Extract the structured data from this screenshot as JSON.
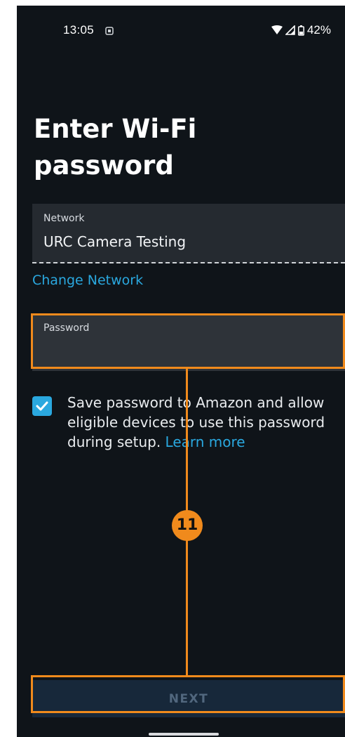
{
  "status_bar": {
    "time": "13:05",
    "battery": "42%"
  },
  "page": {
    "title": "Enter Wi-Fi password"
  },
  "network_field": {
    "label": "Network",
    "value": "URC Camera Testing"
  },
  "change_network_link": "Change Network",
  "password_field": {
    "label": "Password",
    "value": ""
  },
  "save_password": {
    "checked": true,
    "text": "Save password to Amazon and allow eligible devices to use this password during setup.",
    "link": "Learn more"
  },
  "next_button": "NEXT",
  "annotation": {
    "step": "11",
    "color": "#f08a1c"
  },
  "colors": {
    "background": "#0f1419",
    "accent": "#2aa8df",
    "disabled_button": "#17283a"
  }
}
